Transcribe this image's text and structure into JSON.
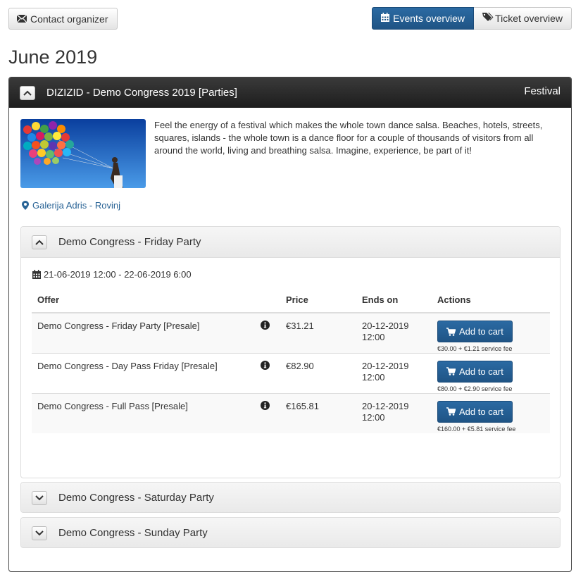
{
  "top_buttons": {
    "contact": "Contact organizer",
    "events_overview": "Events overview",
    "ticket_overview": "Ticket overview"
  },
  "month": "June 2019",
  "event": {
    "title": "DIZIZID - Demo Congress 2019 [Parties]",
    "category": "Festival",
    "description": "Feel the energy of a festival which makes the whole town dance salsa. Beaches, hotels, streets, squares, islands - the whole town is a dance floor for a couple of thousands of visitors from all around the world, living and breathing salsa. Imagine, experience, be part of it!",
    "location": "Galerija Adris - Rovinj",
    "sub_events": [
      {
        "title": "Demo Congress - Friday Party",
        "date_range": "21-06-2019 12:00 - 22-06-2019 6:00",
        "table_headers": [
          "Offer",
          "Price",
          "Ends on",
          "Actions"
        ],
        "offers": [
          {
            "name": "Demo Congress - Friday Party [Presale]",
            "price": "€31.21",
            "ends_date": "20-12-2019",
            "ends_time": "12:00",
            "button": "Add to cart",
            "fee": "€30.00 + €1.21 service fee"
          },
          {
            "name": "Demo Congress - Day Pass Friday [Presale]",
            "price": "€82.90",
            "ends_date": "20-12-2019",
            "ends_time": "12:00",
            "button": "Add to cart",
            "fee": "€80.00 + €2.90 service fee"
          },
          {
            "name": "Demo Congress - Full Pass [Presale]",
            "price": "€165.81",
            "ends_date": "20-12-2019",
            "ends_time": "12:00",
            "button": "Add to cart",
            "fee": "€160.00 + €5.81 service fee"
          }
        ]
      },
      {
        "title": "Demo Congress - Saturday Party"
      },
      {
        "title": "Demo Congress - Sunday Party"
      }
    ]
  },
  "colors": {
    "primary": "#2364a0",
    "header_dark": "#2b2b2b",
    "link": "#2a6496"
  },
  "icons": {
    "contact": "envelope-icon",
    "events": "calendar-icon",
    "ticket": "tags-icon",
    "location": "map-marker-icon",
    "date": "calendar-icon",
    "info": "info-icon",
    "cart": "shopping-cart-icon"
  }
}
